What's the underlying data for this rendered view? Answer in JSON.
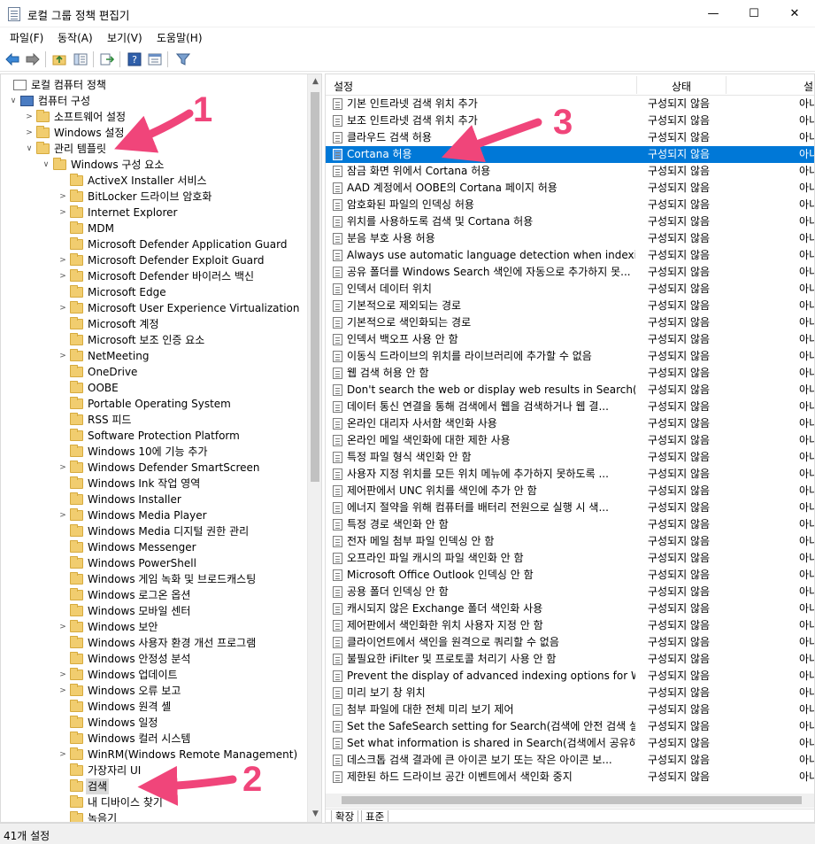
{
  "window": {
    "title": "로컬 그룹 정책 편집기",
    "minimize": "—",
    "maximize": "☐",
    "close": "✕"
  },
  "menu": [
    {
      "label": "파일(F)"
    },
    {
      "label": "동작(A)"
    },
    {
      "label": "보기(V)"
    },
    {
      "label": "도움말(H)"
    }
  ],
  "toolbar": {
    "back_icon": "back-arrow-icon",
    "forward_icon": "forward-arrow-icon",
    "up_icon": "folder-up-icon",
    "show_tree_icon": "show-hide-tree-icon",
    "export_icon": "export-list-icon",
    "help_icon": "help-icon",
    "properties_icon": "properties-icon",
    "filter_icon": "filter-icon"
  },
  "tree": [
    {
      "label": "로컬 컴퓨터 정책",
      "level": 0,
      "expander": "",
      "icon": "doc"
    },
    {
      "label": "컴퓨터 구성",
      "level": 1,
      "expander": "∨",
      "icon": "pc"
    },
    {
      "label": "소프트웨어 설정",
      "level": 2,
      "expander": ">",
      "icon": "folder"
    },
    {
      "label": "Windows 설정",
      "level": 2,
      "expander": ">",
      "icon": "folder"
    },
    {
      "label": "관리 템플릿",
      "level": 2,
      "expander": "∨",
      "icon": "folder"
    },
    {
      "label": "Windows 구성 요소",
      "level": 3,
      "expander": "∨",
      "icon": "folder"
    },
    {
      "label": "ActiveX Installer 서비스",
      "level": 4,
      "expander": "",
      "icon": "folder"
    },
    {
      "label": "BitLocker 드라이브 암호화",
      "level": 4,
      "expander": ">",
      "icon": "folder"
    },
    {
      "label": "Internet Explorer",
      "level": 4,
      "expander": ">",
      "icon": "folder"
    },
    {
      "label": "MDM",
      "level": 4,
      "expander": "",
      "icon": "folder"
    },
    {
      "label": "Microsoft Defender Application Guard",
      "level": 4,
      "expander": "",
      "icon": "folder"
    },
    {
      "label": "Microsoft Defender Exploit Guard",
      "level": 4,
      "expander": ">",
      "icon": "folder"
    },
    {
      "label": "Microsoft Defender 바이러스 백신",
      "level": 4,
      "expander": ">",
      "icon": "folder"
    },
    {
      "label": "Microsoft Edge",
      "level": 4,
      "expander": "",
      "icon": "folder"
    },
    {
      "label": "Microsoft User Experience Virtualization",
      "level": 4,
      "expander": ">",
      "icon": "folder"
    },
    {
      "label": "Microsoft 계정",
      "level": 4,
      "expander": "",
      "icon": "folder"
    },
    {
      "label": "Microsoft 보조 인증 요소",
      "level": 4,
      "expander": "",
      "icon": "folder"
    },
    {
      "label": "NetMeeting",
      "level": 4,
      "expander": ">",
      "icon": "folder"
    },
    {
      "label": "OneDrive",
      "level": 4,
      "expander": "",
      "icon": "folder"
    },
    {
      "label": "OOBE",
      "level": 4,
      "expander": "",
      "icon": "folder"
    },
    {
      "label": "Portable Operating System",
      "level": 4,
      "expander": "",
      "icon": "folder"
    },
    {
      "label": "RSS 피드",
      "level": 4,
      "expander": "",
      "icon": "folder"
    },
    {
      "label": "Software Protection Platform",
      "level": 4,
      "expander": "",
      "icon": "folder"
    },
    {
      "label": "Windows 10에 기능 추가",
      "level": 4,
      "expander": "",
      "icon": "folder"
    },
    {
      "label": "Windows Defender SmartScreen",
      "level": 4,
      "expander": ">",
      "icon": "folder"
    },
    {
      "label": "Windows Ink 작업 영역",
      "level": 4,
      "expander": "",
      "icon": "folder"
    },
    {
      "label": "Windows Installer",
      "level": 4,
      "expander": "",
      "icon": "folder"
    },
    {
      "label": "Windows Media Player",
      "level": 4,
      "expander": ">",
      "icon": "folder"
    },
    {
      "label": "Windows Media 디지털 권한 관리",
      "level": 4,
      "expander": "",
      "icon": "folder"
    },
    {
      "label": "Windows Messenger",
      "level": 4,
      "expander": "",
      "icon": "folder"
    },
    {
      "label": "Windows PowerShell",
      "level": 4,
      "expander": "",
      "icon": "folder"
    },
    {
      "label": "Windows 게임 녹화 및 브로드캐스팅",
      "level": 4,
      "expander": "",
      "icon": "folder"
    },
    {
      "label": "Windows 로그온 옵션",
      "level": 4,
      "expander": "",
      "icon": "folder"
    },
    {
      "label": "Windows 모바일 센터",
      "level": 4,
      "expander": "",
      "icon": "folder"
    },
    {
      "label": "Windows 보안",
      "level": 4,
      "expander": ">",
      "icon": "folder"
    },
    {
      "label": "Windows 사용자 환경 개선 프로그램",
      "level": 4,
      "expander": "",
      "icon": "folder"
    },
    {
      "label": "Windows 안정성 분석",
      "level": 4,
      "expander": "",
      "icon": "folder"
    },
    {
      "label": "Windows 업데이트",
      "level": 4,
      "expander": ">",
      "icon": "folder"
    },
    {
      "label": "Windows 오류 보고",
      "level": 4,
      "expander": ">",
      "icon": "folder"
    },
    {
      "label": "Windows 원격 셸",
      "level": 4,
      "expander": "",
      "icon": "folder"
    },
    {
      "label": "Windows 일정",
      "level": 4,
      "expander": "",
      "icon": "folder"
    },
    {
      "label": "Windows 컬러 시스템",
      "level": 4,
      "expander": "",
      "icon": "folder"
    },
    {
      "label": "WinRM(Windows Remote Management)",
      "level": 4,
      "expander": ">",
      "icon": "folder"
    },
    {
      "label": "가장자리 UI",
      "level": 4,
      "expander": "",
      "icon": "folder"
    },
    {
      "label": "검색",
      "level": 4,
      "expander": "",
      "icon": "folder",
      "selected": true
    },
    {
      "label": "내 디바이스 찾기",
      "level": 4,
      "expander": "",
      "icon": "folder"
    },
    {
      "label": "녹음기",
      "level": 4,
      "expander": "",
      "icon": "folder"
    }
  ],
  "columns": {
    "name": "설정",
    "state": "상태",
    "comment": "설"
  },
  "rows": [
    {
      "name": "기본 인트라넷 검색 위치 추가",
      "state": "구성되지 않음",
      "comment": "아니"
    },
    {
      "name": "보조 인트라넷 검색 위치 추가",
      "state": "구성되지 않음",
      "comment": "아니"
    },
    {
      "name": "클라우드 검색 허용",
      "state": "구성되지 않음",
      "comment": "아니"
    },
    {
      "name": "Cortana 허용",
      "state": "구성되지 않음",
      "comment": "아니",
      "selected": true
    },
    {
      "name": "잠금 화면 위에서 Cortana 허용",
      "state": "구성되지 않음",
      "comment": "아니"
    },
    {
      "name": "AAD 계정에서 OOBE의 Cortana 페이지 허용",
      "state": "구성되지 않음",
      "comment": "아니"
    },
    {
      "name": "암호화된 파일의 인덱싱 허용",
      "state": "구성되지 않음",
      "comment": "아니"
    },
    {
      "name": "위치를 사용하도록 검색 및 Cortana 허용",
      "state": "구성되지 않음",
      "comment": "아니"
    },
    {
      "name": "분음 부호 사용 허용",
      "state": "구성되지 않음",
      "comment": "아니"
    },
    {
      "name": "Always use automatic language detection when indexing c...",
      "state": "구성되지 않음",
      "comment": "아니"
    },
    {
      "name": "공유 폴더를 Windows Search 색인에 자동으로 추가하지 못...",
      "state": "구성되지 않음",
      "comment": "아니"
    },
    {
      "name": "인덱서 데이터 위치",
      "state": "구성되지 않음",
      "comment": "아니"
    },
    {
      "name": "기본적으로 제외되는 경로",
      "state": "구성되지 않음",
      "comment": "아니"
    },
    {
      "name": "기본적으로 색인화되는 경로",
      "state": "구성되지 않음",
      "comment": "아니"
    },
    {
      "name": "인덱서 백오프 사용 안 함",
      "state": "구성되지 않음",
      "comment": "아니"
    },
    {
      "name": "이동식 드라이브의 위치를 라이브러리에 추가할 수 없음",
      "state": "구성되지 않음",
      "comment": "아니"
    },
    {
      "name": "웹 검색 허용 안 함",
      "state": "구성되지 않음",
      "comment": "아니"
    },
    {
      "name": "Don't search the web or display web results in Search(검색...",
      "state": "구성되지 않음",
      "comment": "아니"
    },
    {
      "name": "데이터 통신 연결을 통해 검색에서 웹을 검색하거나 웹 결...",
      "state": "구성되지 않음",
      "comment": "아니"
    },
    {
      "name": "온라인 대리자 사서함 색인화 사용",
      "state": "구성되지 않음",
      "comment": "아니"
    },
    {
      "name": "온라인 메일 색인화에 대한 제한 사용",
      "state": "구성되지 않음",
      "comment": "아니"
    },
    {
      "name": "특정 파일 형식 색인화 안 함",
      "state": "구성되지 않음",
      "comment": "아니"
    },
    {
      "name": "사용자 지정 위치를 모든 위치 메뉴에 추가하지 못하도록 ...",
      "state": "구성되지 않음",
      "comment": "아니"
    },
    {
      "name": "제어판에서 UNC 위치를 색인에 추가 안 함",
      "state": "구성되지 않음",
      "comment": "아니"
    },
    {
      "name": "에너지 절약을 위해 컴퓨터를 배터리 전원으로 실행 시 색...",
      "state": "구성되지 않음",
      "comment": "아니"
    },
    {
      "name": "특정 경로 색인화 안 함",
      "state": "구성되지 않음",
      "comment": "아니"
    },
    {
      "name": "전자 메일 첨부 파일 인덱싱 안 함",
      "state": "구성되지 않음",
      "comment": "아니"
    },
    {
      "name": "오프라인 파일 캐시의 파일 색인화 안 함",
      "state": "구성되지 않음",
      "comment": "아니"
    },
    {
      "name": "Microsoft Office Outlook 인덱싱 안 함",
      "state": "구성되지 않음",
      "comment": "아니"
    },
    {
      "name": "공용 폴더 인덱싱 안 함",
      "state": "구성되지 않음",
      "comment": "아니"
    },
    {
      "name": "캐시되지 않은 Exchange 폴더 색인화 사용",
      "state": "구성되지 않음",
      "comment": "아니"
    },
    {
      "name": "제어판에서 색인화한 위치 사용자 지정 안 함",
      "state": "구성되지 않음",
      "comment": "아니"
    },
    {
      "name": "클라이언트에서 색인을 원격으로 쿼리할 수 없음",
      "state": "구성되지 않음",
      "comment": "아니"
    },
    {
      "name": "불필요한 iFilter 및 프로토콜 처리기 사용 안 함",
      "state": "구성되지 않음",
      "comment": "아니"
    },
    {
      "name": "Prevent the display of advanced indexing options for Wind...",
      "state": "구성되지 않음",
      "comment": "아니"
    },
    {
      "name": "미리 보기 창 위치",
      "state": "구성되지 않음",
      "comment": "아니"
    },
    {
      "name": "첨부 파일에 대한 전체 미리 보기 제어",
      "state": "구성되지 않음",
      "comment": "아니"
    },
    {
      "name": "Set the SafeSearch setting for Search(검색에 안전 검색 설...",
      "state": "구성되지 않음",
      "comment": "아니"
    },
    {
      "name": "Set what information is shared in Search(검색에서 공유하...",
      "state": "구성되지 않음",
      "comment": "아니"
    },
    {
      "name": "데스크톱 검색 결과에 큰 아이콘 보기 또는 작은 아이콘 보...",
      "state": "구성되지 않음",
      "comment": "아니"
    },
    {
      "name": "제한된 하드 드라이브 공간 이벤트에서 색인화 중지",
      "state": "구성되지 않음",
      "comment": "아니"
    }
  ],
  "tabs": [
    {
      "label": "확장"
    },
    {
      "label": "표준"
    }
  ],
  "status": "41개 설정",
  "annotations": [
    {
      "label": "1"
    },
    {
      "label": "2"
    },
    {
      "label": "3"
    }
  ],
  "colors": {
    "selection": "#0078d7",
    "annotation": "#f0457a",
    "folder": "#f1cd6f"
  }
}
